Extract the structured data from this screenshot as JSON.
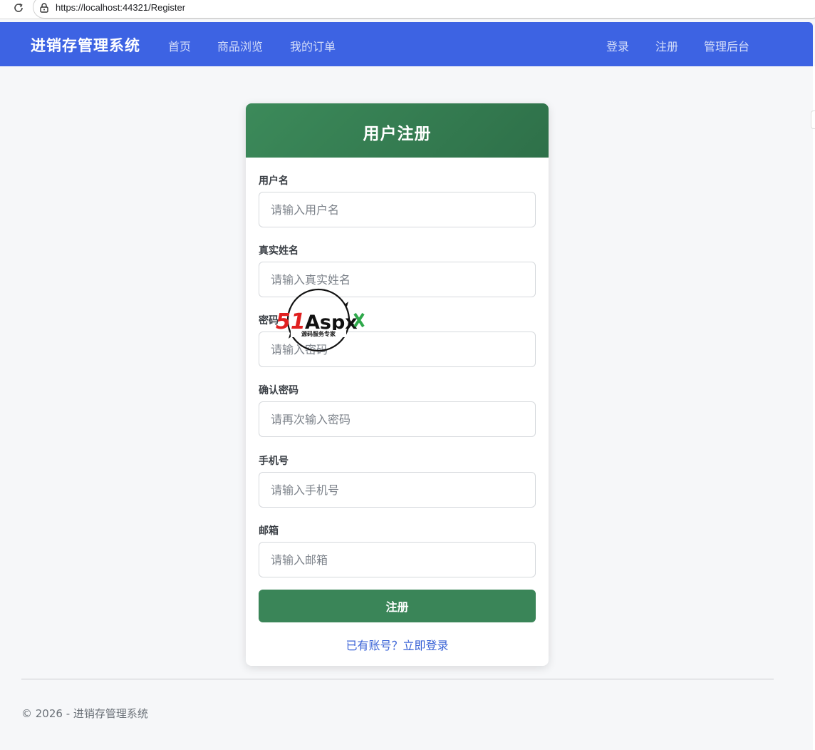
{
  "browser": {
    "url": "https://localhost:44321/Register"
  },
  "navbar": {
    "brand": "进销存管理系统",
    "left_links": [
      "首页",
      "商品浏览",
      "我的订单"
    ],
    "right_links": [
      "登录",
      "注册",
      "管理后台"
    ],
    "background_color": "#3d63e3"
  },
  "form": {
    "title": "用户注册",
    "header_color": "#3a8558",
    "fields": [
      {
        "label": "用户名",
        "placeholder": "请输入用户名"
      },
      {
        "label": "真实姓名",
        "placeholder": "请输入真实姓名"
      },
      {
        "label": "密码",
        "placeholder": "请输入密码"
      },
      {
        "label": "确认密码",
        "placeholder": "请再次输入密码"
      },
      {
        "label": "手机号",
        "placeholder": "请输入手机号"
      },
      {
        "label": "邮箱",
        "placeholder": "请输入邮箱"
      }
    ],
    "submit_label": "注册",
    "login_link": "已有账号？立即登录"
  },
  "watermark": {
    "logo_text": "51Aspx",
    "tagline": "源码服务专家"
  },
  "footer": {
    "text": "© 2026 - 进销存管理系统"
  }
}
